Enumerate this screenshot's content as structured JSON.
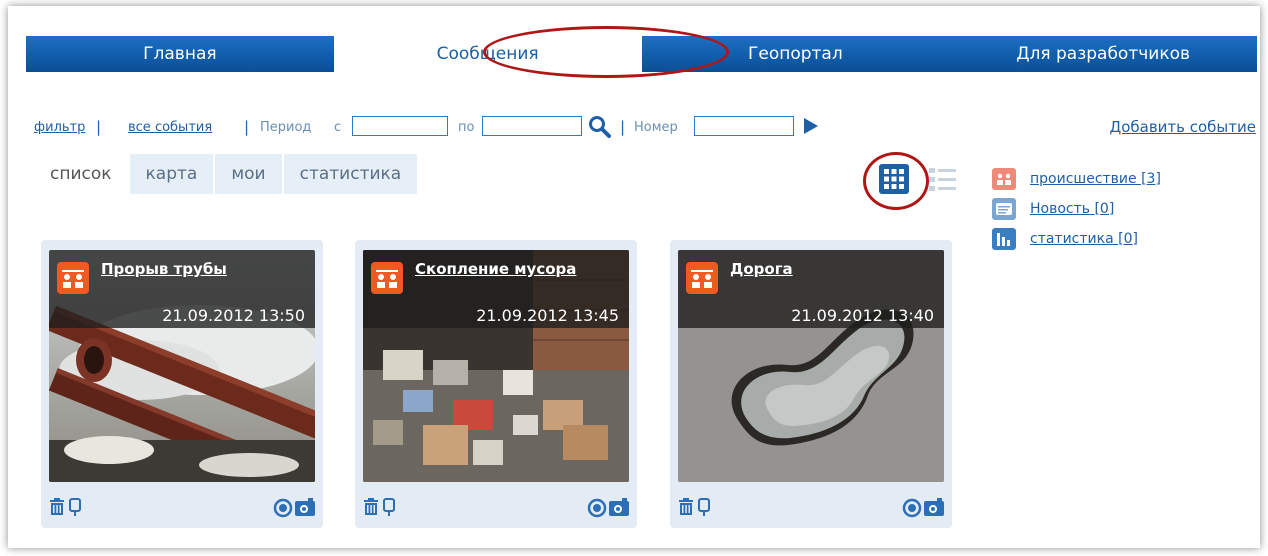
{
  "nav": {
    "items": [
      "Главная",
      "Сообщения",
      "Геопортал",
      "Для разработчиков"
    ],
    "active_index": 1
  },
  "filter": {
    "filter_link": "фильтр",
    "all_events_link": "все события",
    "period_label": "Период",
    "from_label": "с",
    "to_label": "по",
    "number_label": "Номер",
    "from_value": "",
    "to_value": "",
    "number_value": ""
  },
  "add_event": "Добавить событие",
  "tabs": [
    "список",
    "карта",
    "мои",
    "статистика"
  ],
  "active_tab": 0,
  "legend": [
    {
      "label": "происшествие [3]",
      "icon": "incident-icon",
      "color": "#ef5a24"
    },
    {
      "label": "Новость [0]",
      "icon": "news-icon",
      "color": "#3a7fc4"
    },
    {
      "label": "статистика [0]",
      "icon": "statistics-icon",
      "color": "#3a7fc4"
    }
  ],
  "cards": [
    {
      "title": "Прорыв трубы",
      "date": "21.09.2012 13:50",
      "photo": "pipe-burst-photo"
    },
    {
      "title": "Скопление мусора",
      "date": "21.09.2012 13:45",
      "photo": "garbage-photo"
    },
    {
      "title": "Дорога",
      "date": "21.09.2012 13:40",
      "photo": "pothole-photo"
    }
  ],
  "colors": {
    "nav_blue": "#0a4f96",
    "link_blue": "#1f5fa6",
    "highlight_red": "#b01616",
    "incident_orange": "#ef5a24"
  }
}
